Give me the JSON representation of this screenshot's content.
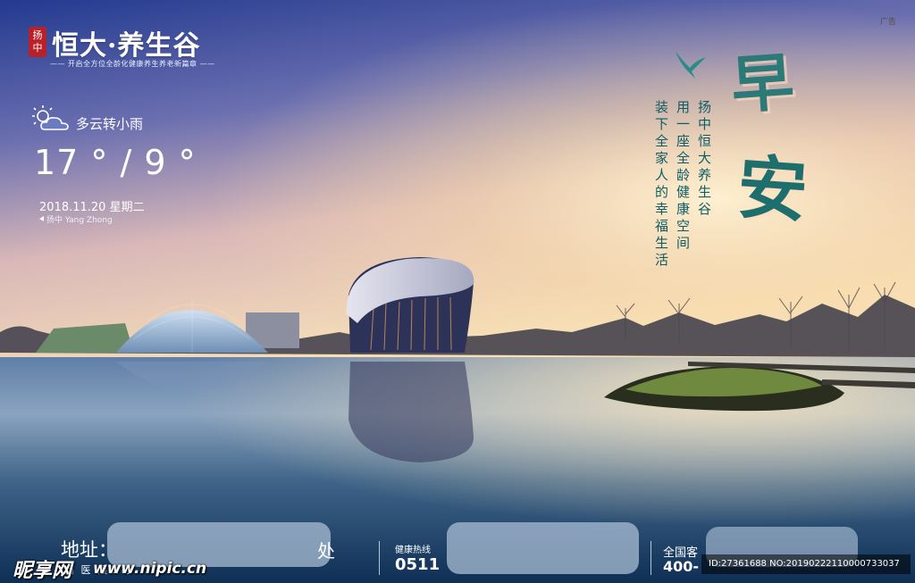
{
  "brand": {
    "seal_text": "扬中",
    "name": "恒大·养生谷",
    "tagline": "—— 开启全方位全龄化健康养生养老新篇章 ——"
  },
  "ad_label": "广告",
  "weather": {
    "icon": "partly-cloudy-icon",
    "condition": "多云转小雨",
    "temperature": "17 ° / 9 °",
    "date": "2018.11.20   星期二",
    "location": "扬中  Yang Zhong"
  },
  "poem": {
    "line1": "扬中恒大养生谷",
    "line2": "用一座全龄健康空间",
    "line3": "装下全家人的幸福生活"
  },
  "greeting": {
    "char1": "早",
    "char2": "安"
  },
  "footer": {
    "address_label": "地址：",
    "address_visible_fragment": "处",
    "address_small": "商    医    限公司",
    "hotline_label": "健康热线",
    "hotline_prefix": "0511",
    "national_label": "全国客",
    "national_prefix": "400-"
  },
  "watermark": {
    "logo": "昵享网",
    "url": "www.nipic.cn",
    "id_text": "ID:27361688 NO:20190222110000733037"
  },
  "colors": {
    "sky_top": "#2c3f91",
    "sky_horizon": "#f6d6a8",
    "water": "#1d4a6e",
    "accent_teal": "#1f6e6e",
    "seal_red": "#b8202a"
  }
}
